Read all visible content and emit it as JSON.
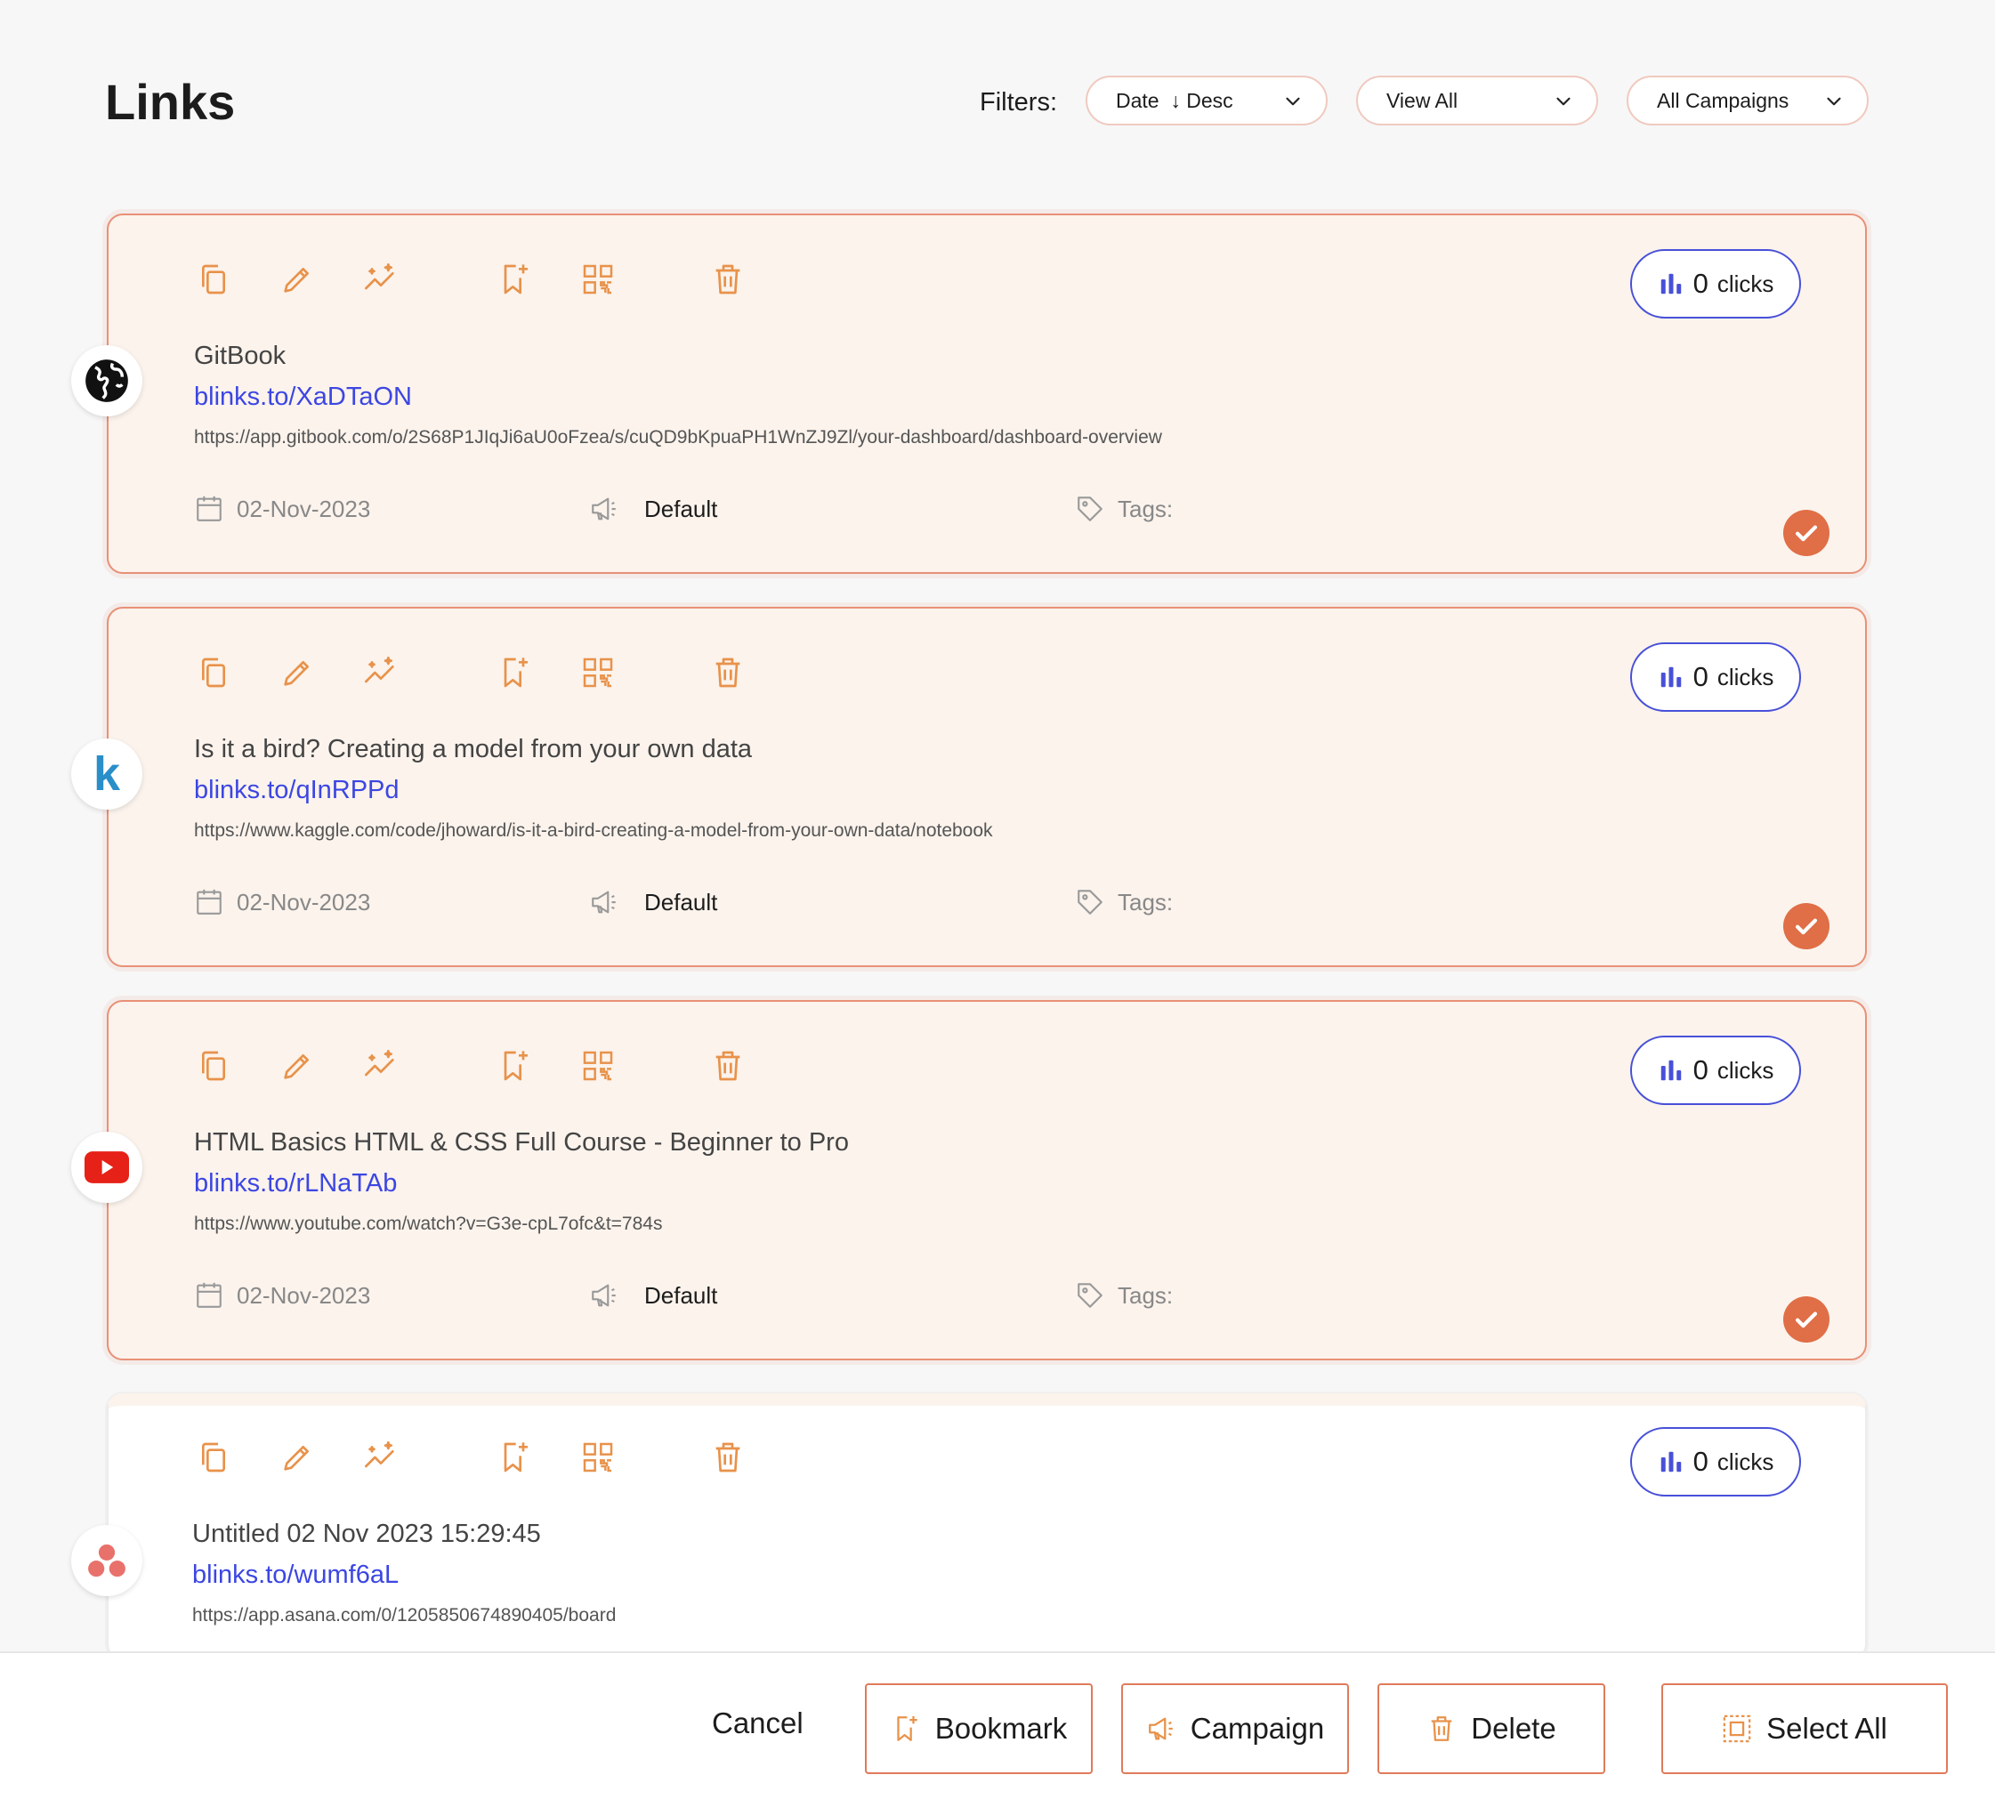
{
  "header": {
    "title": "Links",
    "filters_label": "Filters:",
    "sort_dropdown": "Date  ↓ Desc",
    "view_dropdown": "View All",
    "campaign_dropdown": "All Campaigns"
  },
  "colors": {
    "accent": "#e8924a",
    "selected_border": "#e89077",
    "link_blue": "#3c46e2",
    "clicks_border": "#4850d8",
    "check": "#e06e46"
  },
  "links": [
    {
      "title": "GitBook",
      "short": "blinks.to/XaDTaON",
      "url": "https://app.gitbook.com/o/2S68P1JIqJi6aU0oFzea/s/cuQD9bKpuaPH1WnZJ9Zl/your-dashboard/dashboard-overview",
      "date": "02-Nov-2023",
      "campaign": "Default",
      "tags_label": "Tags:",
      "clicks": "0",
      "clicks_label": "clicks",
      "favicon": "globe-icon",
      "selected": true
    },
    {
      "title": "Is it a bird? Creating a model from your own data",
      "short": "blinks.to/qInRPPd",
      "url": "https://www.kaggle.com/code/jhoward/is-it-a-bird-creating-a-model-from-your-own-data/notebook",
      "date": "02-Nov-2023",
      "campaign": "Default",
      "tags_label": "Tags:",
      "clicks": "0",
      "clicks_label": "clicks",
      "favicon": "kaggle-icon",
      "favicon_text": "k",
      "selected": true
    },
    {
      "title": "HTML Basics HTML & CSS Full Course - Beginner to Pro",
      "short": "blinks.to/rLNaTAb",
      "url": "https://www.youtube.com/watch?v=G3e-cpL7ofc&t=784s",
      "date": "02-Nov-2023",
      "campaign": "Default",
      "tags_label": "Tags:",
      "clicks": "0",
      "clicks_label": "clicks",
      "favicon": "youtube-icon",
      "selected": true
    },
    {
      "title": "Untitled 02 Nov 2023 15:29:45",
      "short": "blinks.to/wumf6aL",
      "url": "https://app.asana.com/0/1205850674890405/board",
      "clicks": "0",
      "clicks_label": "clicks",
      "favicon": "asana-icon",
      "selected": false
    }
  ],
  "bottom_bar": {
    "cancel": "Cancel",
    "bookmark": "Bookmark",
    "campaign": "Campaign",
    "delete": "Delete",
    "select_all": "Select All"
  }
}
